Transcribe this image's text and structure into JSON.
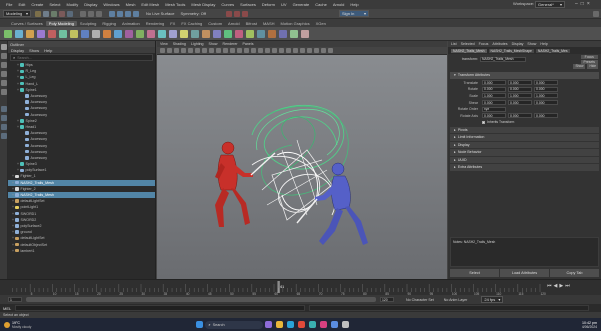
{
  "menubar": {
    "items": [
      "File",
      "Edit",
      "Create",
      "Select",
      "Modify",
      "Display",
      "Windows",
      "Mesh",
      "Edit Mesh",
      "Mesh Tools",
      "Mesh Display",
      "Curves",
      "Surfaces",
      "Deform",
      "UV",
      "Generate",
      "Cache",
      "Arnold",
      "Help"
    ],
    "workspace_label": "Workspace:",
    "workspace_value": "General*"
  },
  "status": {
    "mode": "Modeling",
    "no_live_surface": "No Live Surface",
    "symmetry": "Symmetry: Off",
    "sign_in": "Sign In"
  },
  "shelf_tabs": [
    "Curves / Surfaces",
    "Poly Modeling",
    "Sculpting",
    "Rigging",
    "Animation",
    "Rendering",
    "FX",
    "FX Caching",
    "Custom",
    "Arnold",
    "Bifrost",
    "MASH",
    "Motion Graphics",
    "XGen"
  ],
  "shelf_active": "Poly Modeling",
  "outliner": {
    "title": "Outliner",
    "menu": [
      "Display",
      "Show",
      "Help"
    ],
    "search_placeholder": "Search...",
    "items": [
      {
        "label": "Hips",
        "type": "joint",
        "indent": 1
      },
      {
        "label": "R_Leg",
        "type": "joint",
        "indent": 1
      },
      {
        "label": "L_Leg",
        "type": "joint",
        "indent": 1
      },
      {
        "label": "Hand_L",
        "type": "joint",
        "indent": 1
      },
      {
        "label": "Spine1",
        "type": "joint",
        "indent": 1
      },
      {
        "label": "Accessory",
        "type": "mesh",
        "indent": 2
      },
      {
        "label": "Accessory",
        "type": "mesh",
        "indent": 2
      },
      {
        "label": "Accessory",
        "type": "mesh",
        "indent": 2
      },
      {
        "label": "Accessory",
        "type": "mesh",
        "indent": 2
      },
      {
        "label": "Spine2",
        "type": "joint",
        "indent": 1
      },
      {
        "label": "Head1",
        "type": "joint",
        "indent": 1
      },
      {
        "label": "Accessory",
        "type": "mesh",
        "indent": 2
      },
      {
        "label": "Accessory",
        "type": "mesh",
        "indent": 2
      },
      {
        "label": "Accessory",
        "type": "mesh",
        "indent": 2
      },
      {
        "label": "Accessory",
        "type": "mesh",
        "indent": 2
      },
      {
        "label": "Accessory",
        "type": "mesh",
        "indent": 2
      },
      {
        "label": "Spine3",
        "type": "joint",
        "indent": 1
      },
      {
        "label": "polySurface1",
        "type": "mesh",
        "indent": 1
      },
      {
        "label": "Fighter_1",
        "type": "group",
        "indent": 0
      },
      {
        "label": "NASH2_Trails_Mesh",
        "type": "mesh",
        "indent": 0,
        "selected": true
      },
      {
        "label": "Fighter_2",
        "type": "group",
        "indent": 0
      },
      {
        "label": "NASH2_Trails_Mesh",
        "type": "mesh",
        "indent": 0,
        "selected": true
      },
      {
        "label": "defaultLightSet",
        "type": "set",
        "indent": 0
      },
      {
        "label": "pointLight1",
        "type": "light",
        "indent": 0
      },
      {
        "label": "SWORD1",
        "type": "mesh",
        "indent": 0
      },
      {
        "label": "SWORD2",
        "type": "mesh",
        "indent": 0
      },
      {
        "label": "polySurface2",
        "type": "mesh",
        "indent": 0
      },
      {
        "label": "ground",
        "type": "mesh",
        "indent": 0
      },
      {
        "label": "defaultLightSet",
        "type": "set",
        "indent": 0
      },
      {
        "label": "defaultObjectSet",
        "type": "set",
        "indent": 0
      },
      {
        "label": "lambert1",
        "type": "set",
        "indent": 0
      }
    ]
  },
  "viewport": {
    "menu": [
      "View",
      "Shading",
      "Lighting",
      "Show",
      "Renderer",
      "Panels"
    ]
  },
  "attribute_editor": {
    "tabs": [
      "List",
      "Selected",
      "Focus",
      "Attributes",
      "Display",
      "Show",
      "Help"
    ],
    "node_tabs": [
      "NASH2_Trails_Mesh",
      "NASH2_Trails_MeshShape",
      "NASH2_Trails_Mes"
    ],
    "transform_label": "transform:",
    "transform_value": "NASH2_Trails_Mesh",
    "focus_button": "Focus",
    "presets_button": "Presets",
    "show_button": "Show",
    "hide_button": "Hide",
    "section_open": "Transform Attributes",
    "rows": [
      {
        "label": "Translate",
        "values": [
          "0.000",
          "0.000",
          "0.000"
        ]
      },
      {
        "label": "Rotate",
        "values": [
          "0.000",
          "0.000",
          "0.000"
        ]
      },
      {
        "label": "Scale",
        "values": [
          "1.000",
          "1.000",
          "1.000"
        ]
      },
      {
        "label": "Shear",
        "values": [
          "0.000",
          "0.000",
          "0.000"
        ]
      },
      {
        "label": "Rotate Order",
        "values": [
          "xyz"
        ]
      },
      {
        "label": "Rotate Axis",
        "values": [
          "0.000",
          "0.000",
          "0.000"
        ]
      }
    ],
    "inherits": "Inherits Transform",
    "sections": [
      "Pivots",
      "Limit Information",
      "Display",
      "Node Behavior",
      "UUID",
      "Extra Attributes"
    ],
    "notes_label": "Notes: NASH2_Trails_Mesh",
    "buttons": [
      "Select",
      "Load Attributes",
      "Copy Tab"
    ]
  },
  "timeline": {
    "ticks": [
      "5",
      "10",
      "15",
      "20",
      "25",
      "30",
      "35",
      "40",
      "45",
      "50",
      "55",
      "60",
      "65",
      "70",
      "75",
      "80",
      "85",
      "90",
      "95",
      "100",
      "105",
      "110",
      "115",
      "120"
    ],
    "current_frame": "61",
    "range_start": "1",
    "range_end": "120",
    "no_character_set": "No Character Set",
    "no_anim_layer": "No Anim Layer",
    "fps": "24 fps"
  },
  "cmdline": {
    "lang": "MEL",
    "help": "Select an object"
  },
  "taskbar": {
    "weather_temp": "19°C",
    "weather_text": "Mostly cloudy",
    "search": "Search",
    "time": "10:42 pm",
    "date": "4/06/2024"
  },
  "colors": {
    "selection": "#5285a6",
    "fighter_red": "#c8302a",
    "fighter_blue": "#5560c8",
    "trail_green": "#4ed68a",
    "trail_white": "#f2f2f2"
  }
}
